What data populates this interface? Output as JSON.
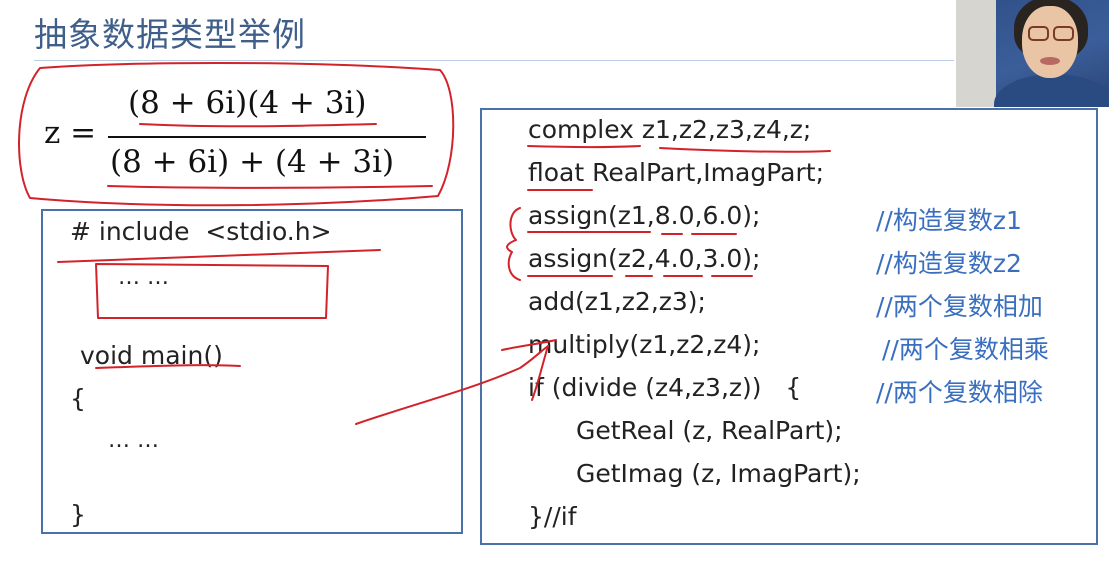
{
  "slide": {
    "title": "抽象数据类型举例",
    "formula": {
      "lhs": "z =",
      "numerator": "(8 + 6i)(4 + 3i)",
      "denominator": "(8 + 6i) + (4 + 3i)"
    },
    "left_box": {
      "lines": [
        "# include  <stdio.h>",
        "… …",
        "void main()",
        "{",
        "… …",
        "}"
      ]
    },
    "right_box": {
      "lines": [
        "complex z1,z2,z3,z4,z;",
        "float RealPart,ImagPart;",
        "assign(z1,8.0,6.0);",
        "assign(z2,4.0,3.0);",
        "add(z1,z2,z3);",
        "multiply(z1,z2,z4);",
        "if (divide (z4,z3,z))   {",
        "GetReal (z, RealPart);",
        "GetImag (z, ImagPart);",
        "}//if"
      ],
      "comments": [
        "//构造复数z1",
        "//构造复数z2",
        "//两个复数相加",
        "//两个复数相乘",
        "//两个复数相除"
      ]
    },
    "colors": {
      "title": "#3f5f8a",
      "box_border": "#4a72a8",
      "comment": "#3a6fc0",
      "annotation": "#d2232a"
    }
  }
}
